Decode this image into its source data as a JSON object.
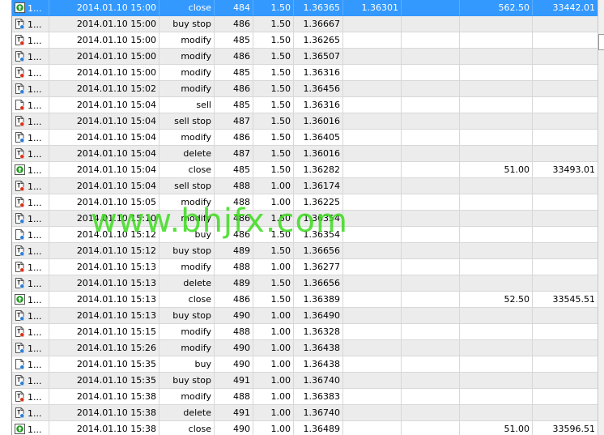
{
  "watermark": "www.bhjfx.com",
  "rows": [
    {
      "icon": "close-arrow-icon",
      "id": "1...",
      "time": "2014.01.10 15:00",
      "type": "close",
      "order": "484",
      "size": "1.50",
      "price": "1.36365",
      "sl": "1.36301",
      "tp": "",
      "profit": "562.50",
      "balance": "33442.01"
    },
    {
      "icon": "buy-stop-icon",
      "id": "1...",
      "time": "2014.01.10 15:00",
      "type": "buy stop",
      "order": "486",
      "size": "1.50",
      "price": "1.36667",
      "sl": "",
      "tp": "",
      "profit": "",
      "balance": ""
    },
    {
      "icon": "modify-sell-icon",
      "id": "1...",
      "time": "2014.01.10 15:00",
      "type": "modify",
      "order": "485",
      "size": "1.50",
      "price": "1.36265",
      "sl": "",
      "tp": "",
      "profit": "",
      "balance": ""
    },
    {
      "icon": "modify-buy-icon",
      "id": "1...",
      "time": "2014.01.10 15:00",
      "type": "modify",
      "order": "486",
      "size": "1.50",
      "price": "1.36507",
      "sl": "",
      "tp": "",
      "profit": "",
      "balance": ""
    },
    {
      "icon": "modify-sell-icon",
      "id": "1...",
      "time": "2014.01.10 15:00",
      "type": "modify",
      "order": "485",
      "size": "1.50",
      "price": "1.36316",
      "sl": "",
      "tp": "",
      "profit": "",
      "balance": ""
    },
    {
      "icon": "modify-buy-icon",
      "id": "1...",
      "time": "2014.01.10 15:02",
      "type": "modify",
      "order": "486",
      "size": "1.50",
      "price": "1.36456",
      "sl": "",
      "tp": "",
      "profit": "",
      "balance": ""
    },
    {
      "icon": "sell-icon",
      "id": "1...",
      "time": "2014.01.10 15:04",
      "type": "sell",
      "order": "485",
      "size": "1.50",
      "price": "1.36316",
      "sl": "",
      "tp": "",
      "profit": "",
      "balance": ""
    },
    {
      "icon": "sell-stop-icon",
      "id": "1...",
      "time": "2014.01.10 15:04",
      "type": "sell stop",
      "order": "487",
      "size": "1.50",
      "price": "1.36016",
      "sl": "",
      "tp": "",
      "profit": "",
      "balance": ""
    },
    {
      "icon": "modify-buy-icon",
      "id": "1...",
      "time": "2014.01.10 15:04",
      "type": "modify",
      "order": "486",
      "size": "1.50",
      "price": "1.36405",
      "sl": "",
      "tp": "",
      "profit": "",
      "balance": ""
    },
    {
      "icon": "delete-sell-icon",
      "id": "1...",
      "time": "2014.01.10 15:04",
      "type": "delete",
      "order": "487",
      "size": "1.50",
      "price": "1.36016",
      "sl": "",
      "tp": "",
      "profit": "",
      "balance": ""
    },
    {
      "icon": "close-arrow-icon",
      "id": "1...",
      "time": "2014.01.10 15:04",
      "type": "close",
      "order": "485",
      "size": "1.50",
      "price": "1.36282",
      "sl": "",
      "tp": "",
      "profit": "51.00",
      "balance": "33493.01"
    },
    {
      "icon": "sell-stop-icon",
      "id": "1...",
      "time": "2014.01.10 15:04",
      "type": "sell stop",
      "order": "488",
      "size": "1.00",
      "price": "1.36174",
      "sl": "",
      "tp": "",
      "profit": "",
      "balance": ""
    },
    {
      "icon": "modify-sell-icon",
      "id": "1...",
      "time": "2014.01.10 15:05",
      "type": "modify",
      "order": "488",
      "size": "1.00",
      "price": "1.36225",
      "sl": "",
      "tp": "",
      "profit": "",
      "balance": ""
    },
    {
      "icon": "modify-buy-icon",
      "id": "1...",
      "time": "2014.01.10 15:10",
      "type": "modify",
      "order": "486",
      "size": "1.50",
      "price": "1.36354",
      "sl": "",
      "tp": "",
      "profit": "",
      "balance": ""
    },
    {
      "icon": "buy-icon",
      "id": "1...",
      "time": "2014.01.10 15:12",
      "type": "buy",
      "order": "486",
      "size": "1.50",
      "price": "1.36354",
      "sl": "",
      "tp": "",
      "profit": "",
      "balance": ""
    },
    {
      "icon": "buy-stop-icon",
      "id": "1...",
      "time": "2014.01.10 15:12",
      "type": "buy stop",
      "order": "489",
      "size": "1.50",
      "price": "1.36656",
      "sl": "",
      "tp": "",
      "profit": "",
      "balance": ""
    },
    {
      "icon": "modify-sell-icon",
      "id": "1...",
      "time": "2014.01.10 15:13",
      "type": "modify",
      "order": "488",
      "size": "1.00",
      "price": "1.36277",
      "sl": "",
      "tp": "",
      "profit": "",
      "balance": ""
    },
    {
      "icon": "delete-buy-icon",
      "id": "1...",
      "time": "2014.01.10 15:13",
      "type": "delete",
      "order": "489",
      "size": "1.50",
      "price": "1.36656",
      "sl": "",
      "tp": "",
      "profit": "",
      "balance": ""
    },
    {
      "icon": "close-arrow-icon",
      "id": "1...",
      "time": "2014.01.10 15:13",
      "type": "close",
      "order": "486",
      "size": "1.50",
      "price": "1.36389",
      "sl": "",
      "tp": "",
      "profit": "52.50",
      "balance": "33545.51"
    },
    {
      "icon": "buy-stop-icon",
      "id": "1...",
      "time": "2014.01.10 15:13",
      "type": "buy stop",
      "order": "490",
      "size": "1.00",
      "price": "1.36490",
      "sl": "",
      "tp": "",
      "profit": "",
      "balance": ""
    },
    {
      "icon": "modify-sell-icon",
      "id": "1...",
      "time": "2014.01.10 15:15",
      "type": "modify",
      "order": "488",
      "size": "1.00",
      "price": "1.36328",
      "sl": "",
      "tp": "",
      "profit": "",
      "balance": ""
    },
    {
      "icon": "modify-buy-icon",
      "id": "1...",
      "time": "2014.01.10 15:26",
      "type": "modify",
      "order": "490",
      "size": "1.00",
      "price": "1.36438",
      "sl": "",
      "tp": "",
      "profit": "",
      "balance": ""
    },
    {
      "icon": "buy-icon",
      "id": "1...",
      "time": "2014.01.10 15:35",
      "type": "buy",
      "order": "490",
      "size": "1.00",
      "price": "1.36438",
      "sl": "",
      "tp": "",
      "profit": "",
      "balance": ""
    },
    {
      "icon": "buy-stop-icon",
      "id": "1...",
      "time": "2014.01.10 15:35",
      "type": "buy stop",
      "order": "491",
      "size": "1.00",
      "price": "1.36740",
      "sl": "",
      "tp": "",
      "profit": "",
      "balance": ""
    },
    {
      "icon": "modify-sell-icon",
      "id": "1...",
      "time": "2014.01.10 15:38",
      "type": "modify",
      "order": "488",
      "size": "1.00",
      "price": "1.36383",
      "sl": "",
      "tp": "",
      "profit": "",
      "balance": ""
    },
    {
      "icon": "delete-buy-icon",
      "id": "1...",
      "time": "2014.01.10 15:38",
      "type": "delete",
      "order": "491",
      "size": "1.00",
      "price": "1.36740",
      "sl": "",
      "tp": "",
      "profit": "",
      "balance": ""
    },
    {
      "icon": "close-arrow-icon",
      "id": "1...",
      "time": "2014.01.10 15:38",
      "type": "close",
      "order": "490",
      "size": "1.00",
      "price": "1.36489",
      "sl": "",
      "tp": "",
      "profit": "51.00",
      "balance": "33596.51"
    }
  ],
  "colors": {
    "selected_row": "#3399ff",
    "alt_row": "#ececec",
    "buy_dot": "#2a7fd8",
    "sell_dot": "#d9341a",
    "close_arrow": "#1a9a1a",
    "watermark": "#3ddc1e"
  }
}
